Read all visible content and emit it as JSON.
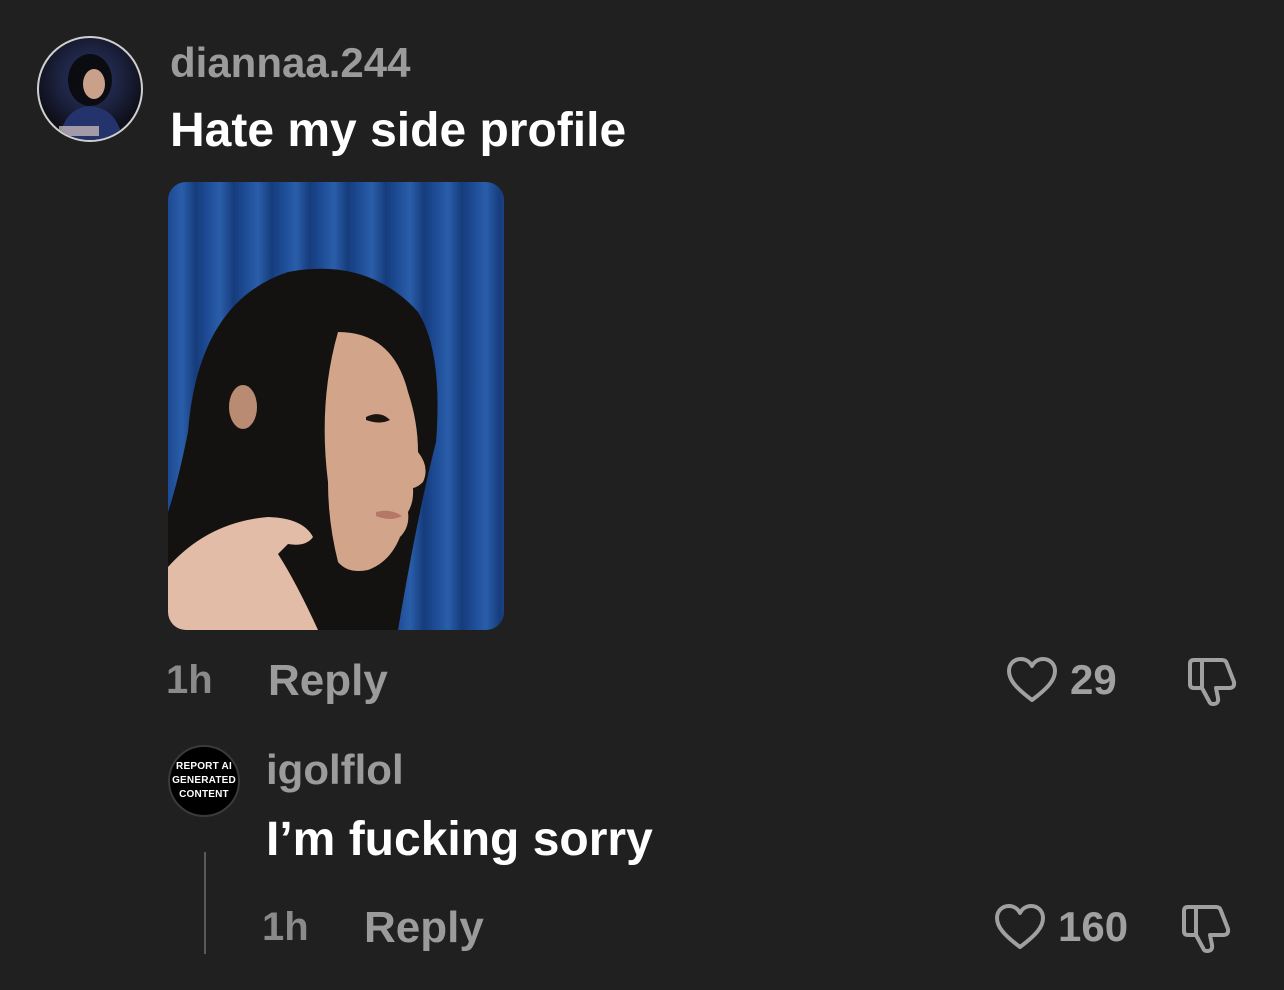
{
  "comments": [
    {
      "username": "diannaa.244",
      "text": "Hate my side profile",
      "time": "1h",
      "reply_label": "Reply",
      "likes": "29",
      "has_photo": true
    },
    {
      "username": "igolflol",
      "avatar_text": [
        "REPORT AI",
        "GENERATED",
        "CONTENT"
      ],
      "text": "I’m fucking sorry",
      "time": "1h",
      "reply_label": "Reply",
      "likes": "160"
    }
  ],
  "icons": {
    "like": "heart-outline-icon",
    "dislike": "thumbs-down-outline-icon"
  },
  "colors": {
    "background": "#202020",
    "username": "#9b9b9b",
    "text": "#ffffff",
    "meta": "#8a8a8a"
  }
}
